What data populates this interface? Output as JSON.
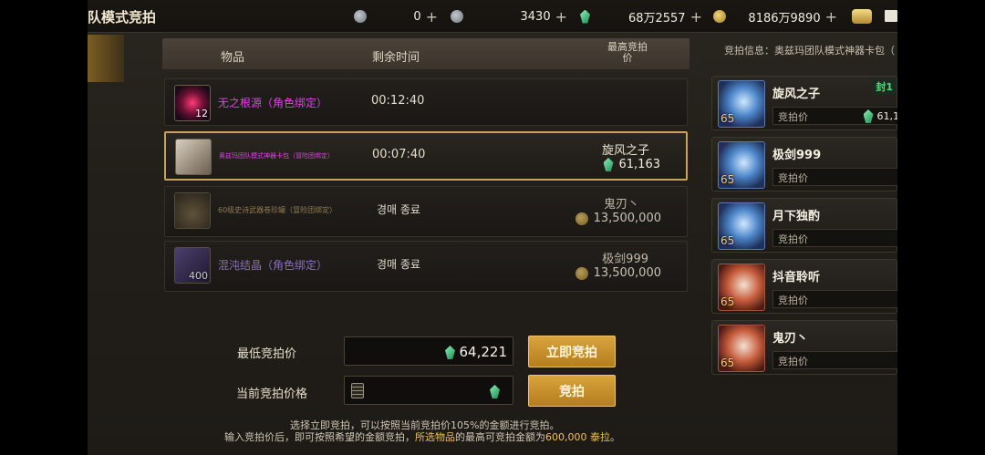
{
  "header": {
    "title": "队模式竞拍",
    "currencies": [
      {
        "icon": "silver-c-coin-icon",
        "value": "0"
      },
      {
        "icon": "silver-c-coin-icon",
        "value": "3430"
      },
      {
        "icon": "green-gem-icon",
        "value": "68万2557"
      },
      {
        "icon": "gold-coin-icon",
        "value": "8186万9890"
      }
    ],
    "plus": "+"
  },
  "list": {
    "columns": {
      "item": "物品",
      "time": "剩余时间",
      "bid": "最高竞拍\n价"
    },
    "rows": [
      {
        "name": "无之根源（角色绑定）",
        "name_color": "#e040e8",
        "time": "00:12:40",
        "bidder": "",
        "amount": "",
        "qty": "12",
        "selected": false
      },
      {
        "name": "奥兹玛团队模式神器卡包（冒险团绑定）",
        "name_color": "#e040e8",
        "time": "00:07:40",
        "bidder": "旋风之子",
        "amount": "61,163",
        "amount_icon": "green-gem-icon",
        "qty": "",
        "selected": true
      },
      {
        "name": "60级史诗武器卷珍罐（冒险团绑定）",
        "name_color": "#8f7a52",
        "time": "경매 종료",
        "bidder": "鬼刃丶",
        "amount": "13,500,000",
        "amount_icon": "gold-coin-icon",
        "qty": "",
        "selected": false
      },
      {
        "name": "混沌结晶（角色绑定）",
        "name_color": "#8a6fc0",
        "time": "경매 종료",
        "bidder": "极剑999",
        "amount": "13,500,000",
        "amount_icon": "gold-coin-icon",
        "qty": "400",
        "selected": false
      }
    ]
  },
  "controls": {
    "min_bid_label": "最低竞拍价",
    "min_bid_value": "64,221",
    "buyout_button": "立即竞拍",
    "current_bid_label": "当前竞拍价格",
    "bid_button": "竞拍",
    "notice_line1": "选择立即竞拍，可以按照当前竞拍价105%的金额进行竞拍。",
    "notice_line2_a": "输入竞拍价后，即可按照希望的金额竞拍，",
    "notice_line2_hl1": "所选物品",
    "notice_line2_b": "的最高可竞拍金额为",
    "notice_line2_hl2": "600,000 泰拉",
    "notice_line2_c": "。"
  },
  "bid_info": {
    "title": "竞拍信息：奥兹玛团队模式神器卡包（",
    "field_label": "竞拍价",
    "bidders": [
      {
        "name": "旋风之子",
        "level": "65",
        "amount": "61,1",
        "tag": "封1",
        "avatar": "blue"
      },
      {
        "name": "极剑999",
        "level": "65",
        "amount": "",
        "tag": "",
        "avatar": "blue"
      },
      {
        "name": "月下独酌",
        "level": "65",
        "amount": "",
        "tag": "",
        "avatar": "blue"
      },
      {
        "name": "抖音聆听",
        "level": "65",
        "amount": "",
        "tag": "",
        "avatar": "red"
      },
      {
        "name": "鬼刃丶",
        "level": "65",
        "amount": "",
        "tag": "",
        "avatar": "red"
      }
    ]
  },
  "colors": {
    "accent_gold": "#d9a43c",
    "selected_border": "#c7a558",
    "gem_green": "#3ccf82"
  }
}
